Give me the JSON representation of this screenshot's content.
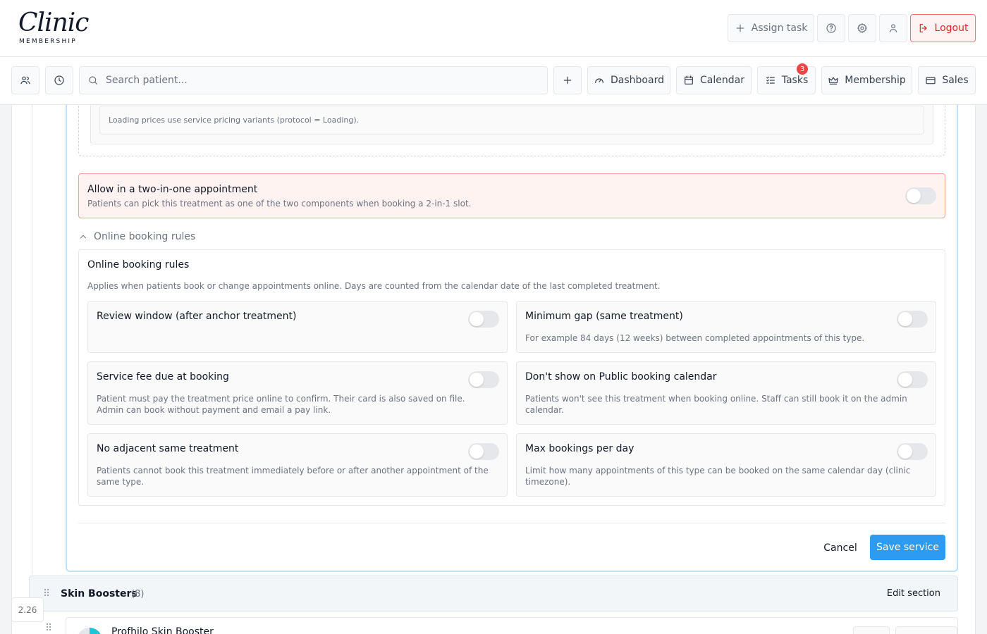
{
  "header": {
    "logo_script": "Clinic",
    "logo_sub": "MEMBERSHIP",
    "assign_task_label": "Assign task",
    "logout_label": "Logout"
  },
  "nav": {
    "search_placeholder": "Search patient...",
    "dashboard_label": "Dashboard",
    "calendar_label": "Calendar",
    "tasks_label": "Tasks",
    "tasks_badge": "3",
    "membership_label": "Membership",
    "sales_label": "Sales"
  },
  "pricing": {
    "note": "Loading prices use service pricing variants (protocol = Loading)."
  },
  "two_in_one": {
    "title": "Allow in a two-in-one appointment",
    "description": "Patients can pick this treatment as one of the two components when booking a 2-in-1 slot.",
    "enabled": false
  },
  "online_booking": {
    "collapse_label": "Online booking rules",
    "title": "Online booking rules",
    "description": "Applies when patients book or change appointments online. Days are counted from the calendar date of the last completed treatment.",
    "rules": [
      {
        "title": "Review window (after anchor treatment)",
        "description": "",
        "enabled": false
      },
      {
        "title": "Minimum gap (same treatment)",
        "description": "For example 84 days (12 weeks) between completed appointments of this type.",
        "enabled": false
      },
      {
        "title": "Service fee due at booking",
        "description": "Patient must pay the treatment price online to confirm. Their card is also saved on file. Admin can book without payment and email a pay link.",
        "enabled": false
      },
      {
        "title": "Don't show on Public booking calendar",
        "description": "Patients won't see this treatment when booking online. Staff can still book it on the admin calendar.",
        "enabled": false
      },
      {
        "title": "No adjacent same treatment",
        "description": "Patients cannot book this treatment immediately before or after another appointment of the same type.",
        "enabled": false
      },
      {
        "title": "Max bookings per day",
        "description": "Limit how many appointments of this type can be booked on the same calendar day (clinic timezone).",
        "enabled": false
      }
    ]
  },
  "actions": {
    "cancel_label": "Cancel",
    "save_label": "Save service"
  },
  "section": {
    "title": "Skin Boosters",
    "count": "(8)",
    "edit_label": "Edit section"
  },
  "service": {
    "name": "Profhilo Skin Booster"
  },
  "version": "2.26",
  "colors": {
    "accent": "#2f9bf0",
    "danger": "#dc2626",
    "badge": "#ef4444",
    "two_in_one_bg": "#fef3f0"
  }
}
